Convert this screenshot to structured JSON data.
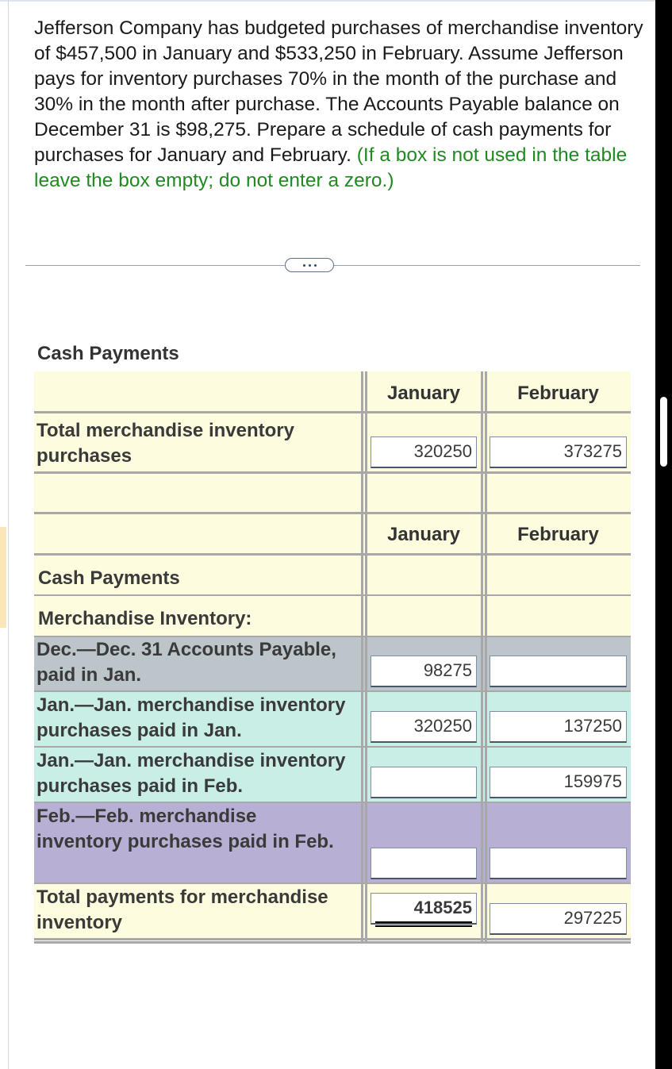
{
  "question": {
    "text": "Jefferson Company has budgeted purchases of merchandise inventory of $457,500 in January and $533,250 in February. Assume  Jefferson pays for inventory purchases 70% in the month of the purchase and 30% in the month after purchase. The Accounts Payable balance on December 31 is $98,275. Prepare a schedule of cash payments for purchases for January and February.",
    "hint": "(If a box is not used in the table leave the box empty; do not enter a zero.)"
  },
  "section_title": "Cash Payments",
  "table1": {
    "col_january": "January",
    "col_february": "February",
    "row_label": "Total merchandise inventory purchases",
    "january_value": "320250",
    "february_value": "373275"
  },
  "table2": {
    "col_january": "January",
    "col_february": "February",
    "cash_payments_label": "Cash Payments",
    "merch_label": "Merchandise Inventory:",
    "rows": [
      {
        "label": "Dec.—Dec. 31 Accounts Payable, paid in Jan.",
        "january": "98275",
        "february": ""
      },
      {
        "label": "Jan.—Jan. merchandise inventory purchases paid in Jan.",
        "january": "320250",
        "february": "137250"
      },
      {
        "label": "Jan.—Jan. merchandise inventory purchases paid in Feb.",
        "january": "",
        "february": "159975"
      },
      {
        "label": "Feb.—Feb. merchandise inventory purchases paid in Feb.",
        "january": "",
        "february": ""
      }
    ],
    "total_label": "Total payments for merchandise inventory",
    "total_january": "418525",
    "total_february": "297225"
  },
  "colors": {
    "yellow_row": "#fdfcdf",
    "gray_row": "#bcc5c9",
    "mint_row": "#c8eee6",
    "purple_row": "#b7afd4",
    "hint_green": "#1f8a1f"
  }
}
